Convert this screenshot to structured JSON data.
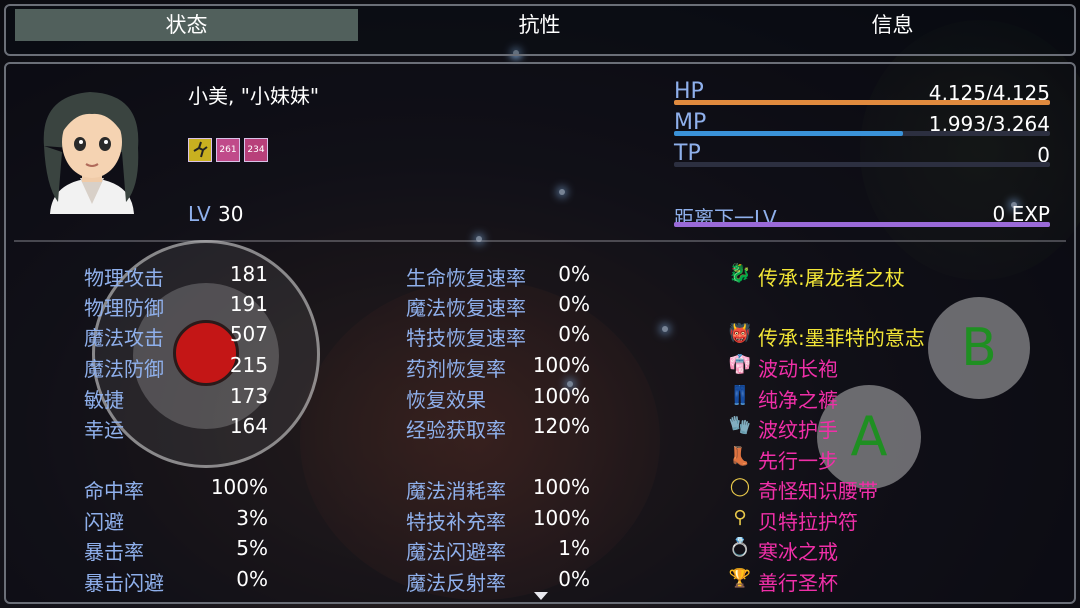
{
  "tabs": [
    {
      "label": "状态",
      "active": true
    },
    {
      "label": "抗性",
      "active": false
    },
    {
      "label": "信息",
      "active": false
    }
  ],
  "actor": {
    "name_line": "小美, \"小妹妹\"",
    "level_label": "LV",
    "level": "30",
    "states": [
      {
        "icon": "running-icon",
        "text": ""
      },
      {
        "icon": "buff-icon",
        "text": "261"
      },
      {
        "icon": "buff-icon",
        "text": "234"
      }
    ]
  },
  "gauges": {
    "hp": {
      "label": "HP",
      "value": "4,125/4,125",
      "fill": 1.0,
      "color": "#e08a3e"
    },
    "mp": {
      "label": "MP",
      "value": "1,993/3,264",
      "fill": 0.61,
      "color": "#3a92d8"
    },
    "tp": {
      "label": "TP",
      "value": "0",
      "fill": 0.0,
      "color": "#5a9a3a"
    },
    "exp": {
      "label": "距离下一LV",
      "value": "0 EXP",
      "fill": 1.0,
      "color": "#9a6ad8"
    }
  },
  "params": [
    {
      "label": "物理攻击",
      "value": "181"
    },
    {
      "label": "物理防御",
      "value": "191"
    },
    {
      "label": "魔法攻击",
      "value": "507"
    },
    {
      "label": "魔法防御",
      "value": "215"
    },
    {
      "label": "敏捷",
      "value": "173"
    },
    {
      "label": "幸运",
      "value": "164"
    }
  ],
  "xparams": [
    {
      "label": "命中率",
      "value": "100%"
    },
    {
      "label": "闪避",
      "value": "3%"
    },
    {
      "label": "暴击率",
      "value": "5%"
    },
    {
      "label": "暴击闪避",
      "value": "0%"
    }
  ],
  "rates": [
    {
      "label": "生命恢复速率",
      "value": "0%"
    },
    {
      "label": "魔法恢复速率",
      "value": "0%"
    },
    {
      "label": "特技恢复速率",
      "value": "0%"
    },
    {
      "label": "药剂恢复率",
      "value": "100%"
    },
    {
      "label": "恢复效果",
      "value": "100%"
    },
    {
      "label": "经验获取率",
      "value": "120%"
    }
  ],
  "rates2": [
    {
      "label": "魔法消耗率",
      "value": "100%"
    },
    {
      "label": "特技补充率",
      "value": "100%"
    },
    {
      "label": "魔法闪避率",
      "value": "1%"
    },
    {
      "label": "魔法反射率",
      "value": "0%"
    }
  ],
  "equipment": [
    {
      "name": "传承:屠龙者之杖",
      "icon": "dragon-staff-icon",
      "glyph": "🐉",
      "color": "#f2e637"
    },
    {
      "name": "",
      "icon": "",
      "glyph": "",
      "color": "#ffffff"
    },
    {
      "name": "传承:墨菲特的意志",
      "icon": "helmet-icon",
      "glyph": "👹",
      "color": "#f2e637"
    },
    {
      "name": "波动长袍",
      "icon": "robe-icon",
      "glyph": "👘",
      "color": "#f02fa8"
    },
    {
      "name": "纯净之裤",
      "icon": "pants-icon",
      "glyph": "👖",
      "color": "#f02fa8"
    },
    {
      "name": "波纹护手",
      "icon": "glove-icon",
      "glyph": "🧤",
      "color": "#f02fa8"
    },
    {
      "name": "先行一步",
      "icon": "boots-icon",
      "glyph": "👢",
      "color": "#f02fa8"
    },
    {
      "name": "奇怪知识腰带",
      "icon": "belt-icon",
      "glyph": "◯",
      "color": "#f02fa8"
    },
    {
      "name": "贝特拉护符",
      "icon": "amulet-icon",
      "glyph": "⚲",
      "color": "#f02fa8"
    },
    {
      "name": "寒冰之戒",
      "icon": "ring-icon",
      "glyph": "💍",
      "color": "#f02fa8"
    },
    {
      "name": "善行圣杯",
      "icon": "chalice-icon",
      "glyph": "🏆",
      "color": "#f02fa8"
    }
  ],
  "virtual_buttons": {
    "a": "A",
    "b": "B"
  },
  "colors": {
    "label": "#8fb0ec",
    "panel_border": "#6b6f78",
    "active_tab": "#51605c"
  }
}
